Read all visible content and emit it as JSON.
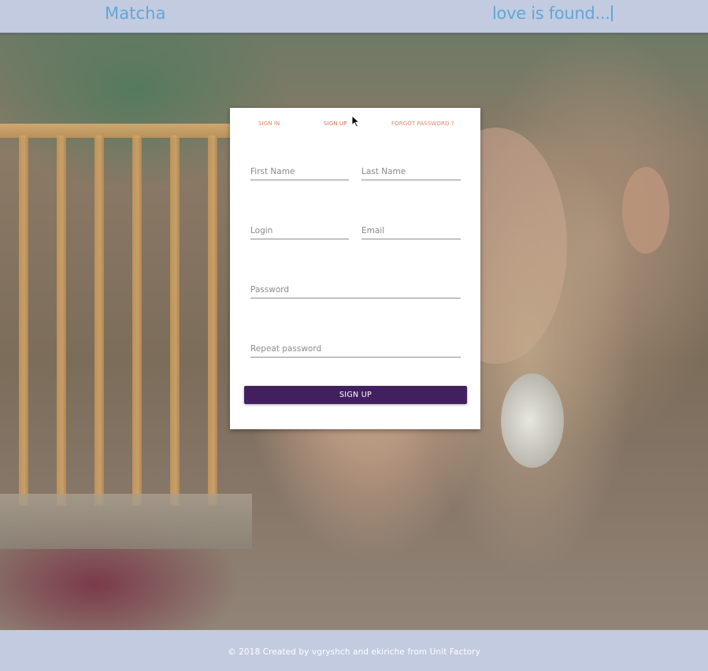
{
  "header": {
    "brand": "Matcha",
    "tagline": "love is found..."
  },
  "auth": {
    "tabs": [
      {
        "label": "SIGN IN",
        "active": false
      },
      {
        "label": "SIGN UP",
        "active": true
      },
      {
        "label": "FORGOT PASSWORD ?",
        "active": false
      }
    ],
    "fields": {
      "first_name": {
        "placeholder": "First Name",
        "value": ""
      },
      "last_name": {
        "placeholder": "Last Name",
        "value": ""
      },
      "login": {
        "placeholder": "Login",
        "value": ""
      },
      "email": {
        "placeholder": "Email",
        "value": ""
      },
      "password": {
        "placeholder": "Password",
        "value": ""
      },
      "repeat_password": {
        "placeholder": "Repeat password",
        "value": ""
      }
    },
    "submit_label": "SIGN UP"
  },
  "footer": {
    "text": "© 2018 Created by vgryshch and ekiriche from Unit Factory"
  },
  "colors": {
    "bar_background": "#c2cbdf",
    "brand_text": "#62a6da",
    "tab_text": "#e7826b",
    "button_background": "#42205f",
    "button_text": "#ffffff"
  }
}
